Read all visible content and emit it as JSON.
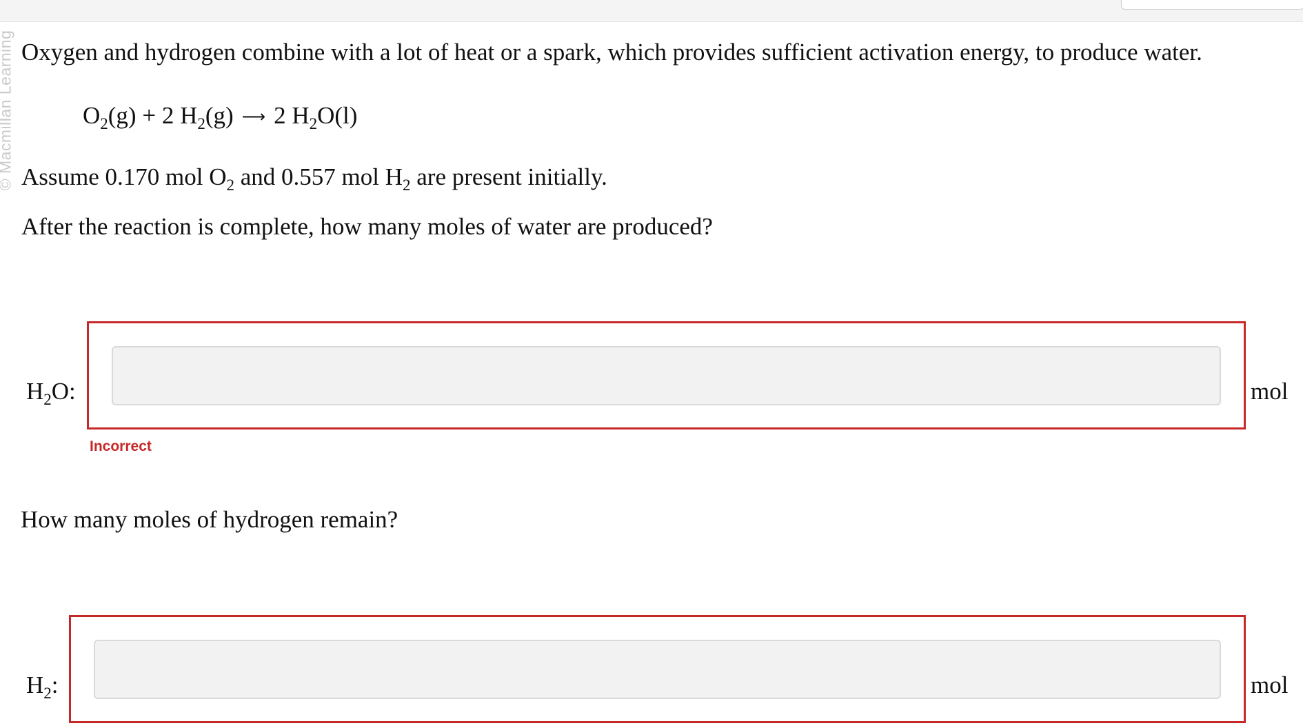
{
  "watermark": "© Macmillan Learning",
  "question": {
    "intro": "Oxygen and hydrogen combine with a lot of heat or a spark, which provides sufficient activation energy, to produce water.",
    "equation": {
      "left": [
        "O",
        "2",
        "(g) + 2 H",
        "2",
        "(g)"
      ],
      "arrow": "⟶",
      "right": [
        "2 H",
        "2",
        "O(l)"
      ]
    },
    "assumption": [
      "Assume 0.170 mol O",
      "2",
      " and 0.557 mol H",
      "2",
      " are present initially."
    ],
    "prompt": "After the reaction is complete, how many moles of water are produced?"
  },
  "answers": [
    {
      "label": [
        "H",
        "2",
        "O:"
      ],
      "value": "",
      "placeholder": "",
      "unit": "mol",
      "status": "Incorrect"
    },
    {
      "prompt": "How many moles of hydrogen remain?",
      "label": [
        "H",
        "2",
        ":"
      ],
      "value": "",
      "placeholder": "",
      "unit": "mol",
      "status": ""
    }
  ],
  "colors": {
    "error": "#c62828",
    "input_bg": "#f2f2f2"
  }
}
